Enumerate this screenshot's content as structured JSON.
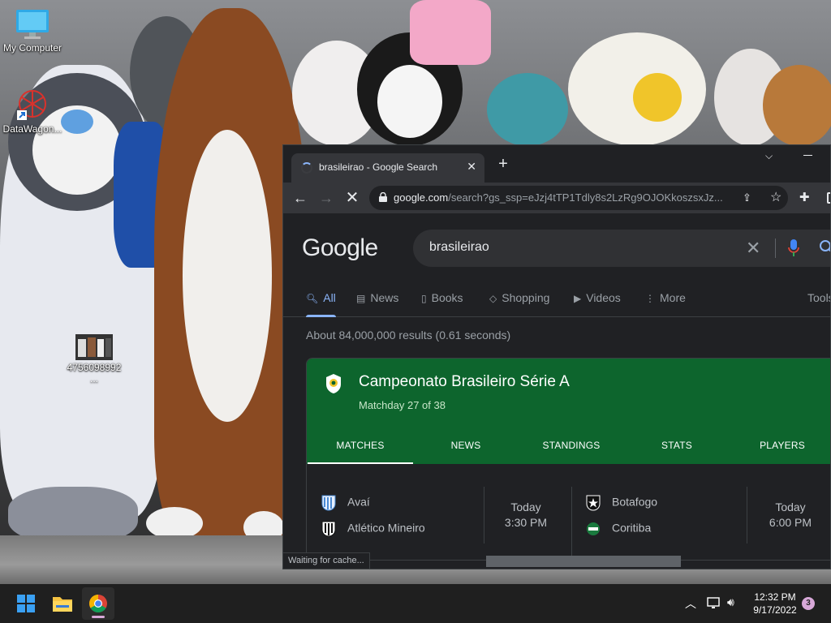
{
  "desktop": {
    "icons": [
      {
        "label": "My Computer"
      },
      {
        "label": "DataWagon..."
      },
      {
        "label": "4756098992 ..."
      }
    ]
  },
  "browser": {
    "tab_title": "brasileirao - Google Search",
    "url_host": "google.com",
    "url_rest": "/search?gs_ssp=eJzj4tTP1Tdly8s2LzRg9OJOKkoszsxJz...",
    "status_text": "Waiting for cache..."
  },
  "google": {
    "logo": "Google",
    "query": "brasileirao",
    "tabs": [
      {
        "label": "All",
        "active": true
      },
      {
        "label": "News",
        "active": false
      },
      {
        "label": "Books",
        "active": false
      },
      {
        "label": "Shopping",
        "active": false
      },
      {
        "label": "Videos",
        "active": false
      },
      {
        "label": "More",
        "active": false
      },
      {
        "label": "Tools",
        "active": false
      }
    ],
    "result_stats": "About 84,000,000 results (0.61 seconds)",
    "sports_card": {
      "league": "Campeonato Brasileiro Série A",
      "matchday": "Matchday 27 of 38",
      "tabs": [
        "MATCHES",
        "NEWS",
        "STANDINGS",
        "STATS",
        "PLAYERS"
      ],
      "matches": [
        {
          "home": "Avaí",
          "away": "Atlético Mineiro",
          "day": "Today",
          "time": "3:30 PM"
        },
        {
          "home": "Botafogo",
          "away": "Coritiba",
          "day": "Today",
          "time": "6:00 PM"
        }
      ]
    }
  },
  "taskbar": {
    "time": "12:32 PM",
    "date": "9/17/2022",
    "notifications": "3"
  },
  "colors": {
    "card_header": "#0d652d",
    "active_tab": "#8ab4f8",
    "page_bg": "#202124"
  }
}
